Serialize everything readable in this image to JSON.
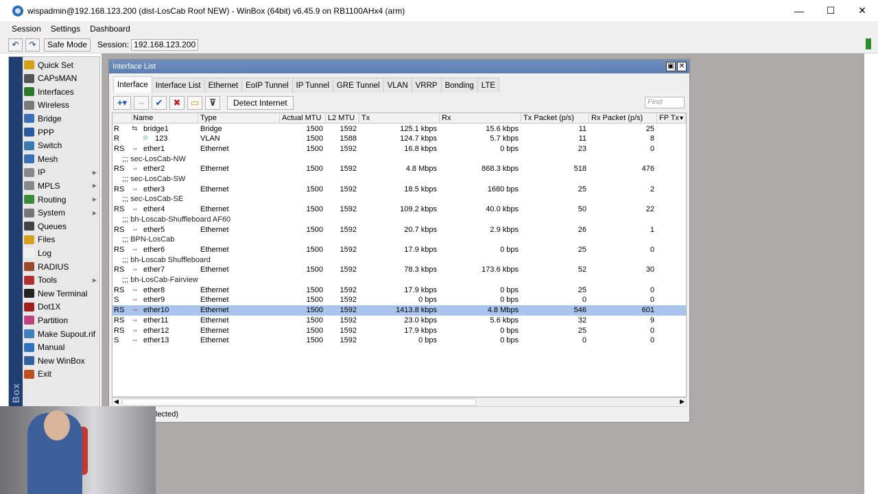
{
  "window": {
    "title": "wispadmin@192.168.123.200 (dist-LosCab Roof NEW) - WinBox (64bit) v6.45.9 on RB1100AHx4 (arm)",
    "minimize": "—",
    "maximize": "☐",
    "close": "✕"
  },
  "menubar": [
    "Session",
    "Settings",
    "Dashboard"
  ],
  "toolbar": {
    "undo": "↶",
    "redo": "↷",
    "safe_mode": "Safe Mode",
    "session_label": "Session:",
    "session_value": "192.168.123.200"
  },
  "sidebar": {
    "brand": "RouterOS WinBox",
    "items": [
      {
        "label": "Quick Set",
        "color": "#d4a017",
        "arrow": false
      },
      {
        "label": "CAPsMAN",
        "color": "#555555",
        "arrow": false
      },
      {
        "label": "Interfaces",
        "color": "#2b7a2b",
        "arrow": false
      },
      {
        "label": "Wireless",
        "color": "#7a7a7a",
        "arrow": false
      },
      {
        "label": "Bridge",
        "color": "#3b6fb6",
        "arrow": false
      },
      {
        "label": "PPP",
        "color": "#2a5aa0",
        "arrow": false
      },
      {
        "label": "Switch",
        "color": "#3a7ab0",
        "arrow": false
      },
      {
        "label": "Mesh",
        "color": "#3b6fb6",
        "arrow": false
      },
      {
        "label": "IP",
        "color": "#888888",
        "arrow": true
      },
      {
        "label": "MPLS",
        "color": "#888888",
        "arrow": true
      },
      {
        "label": "Routing",
        "color": "#3a8a3a",
        "arrow": true
      },
      {
        "label": "System",
        "color": "#777777",
        "arrow": true
      },
      {
        "label": "Queues",
        "color": "#444444",
        "arrow": false
      },
      {
        "label": "Files",
        "color": "#d8a020",
        "arrow": false
      },
      {
        "label": "Log",
        "color": "#f0f0f0",
        "arrow": false
      },
      {
        "label": "RADIUS",
        "color": "#9a4a2a",
        "arrow": false
      },
      {
        "label": "Tools",
        "color": "#b03030",
        "arrow": true
      },
      {
        "label": "New Terminal",
        "color": "#222222",
        "arrow": false
      },
      {
        "label": "Dot1X",
        "color": "#a02020",
        "arrow": false
      },
      {
        "label": "Partition",
        "color": "#c04080",
        "arrow": false
      },
      {
        "label": "Make Supout.rif",
        "color": "#4080c0",
        "arrow": false
      },
      {
        "label": "Manual",
        "color": "#3070c0",
        "arrow": false
      },
      {
        "label": "New WinBox",
        "color": "#3060a0",
        "arrow": false
      },
      {
        "label": "Exit",
        "color": "#c05020",
        "arrow": false
      }
    ]
  },
  "interface_window": {
    "title": "Interface List",
    "tabs": [
      "Interface",
      "Interface List",
      "Ethernet",
      "EoIP Tunnel",
      "IP Tunnel",
      "GRE Tunnel",
      "VLAN",
      "VRRP",
      "Bonding",
      "LTE"
    ],
    "actions": {
      "add": "+▾",
      "remove": "−",
      "enable": "✔",
      "disable": "✖",
      "comment": "▭",
      "filter": "⊽",
      "detect": "Detect Internet"
    },
    "find_placeholder": "Find",
    "columns": [
      "Name",
      "Type",
      "Actual MTU",
      "L2 MTU",
      "Tx",
      "Rx",
      "Tx Packet (p/s)",
      "Rx Packet (p/s)",
      "FP Tx"
    ],
    "rows": [
      {
        "kind": "iface",
        "flags": "R",
        "icon": "bridge",
        "name": "bridge1",
        "type": "Bridge",
        "mtu": "1500",
        "l2mtu": "1592",
        "tx": "125.1 kbps",
        "rx": "15.6 kbps",
        "txp": "11",
        "rxp": "25"
      },
      {
        "kind": "iface",
        "flags": "R",
        "icon": "vlan",
        "name": "123",
        "type": "VLAN",
        "mtu": "1500",
        "l2mtu": "1588",
        "tx": "124.7 kbps",
        "rx": "5.7 kbps",
        "txp": "11",
        "rxp": "8"
      },
      {
        "kind": "iface",
        "flags": "RS",
        "icon": "eth",
        "name": "ether1",
        "type": "Ethernet",
        "mtu": "1500",
        "l2mtu": "1592",
        "tx": "16.8 kbps",
        "rx": "0 bps",
        "txp": "23",
        "rxp": "0"
      },
      {
        "kind": "comment",
        "text": ";;; sec-LosCab-NW"
      },
      {
        "kind": "iface",
        "flags": "RS",
        "icon": "eth",
        "name": "ether2",
        "type": "Ethernet",
        "mtu": "1500",
        "l2mtu": "1592",
        "tx": "4.8 Mbps",
        "rx": "868.3 kbps",
        "txp": "518",
        "rxp": "476"
      },
      {
        "kind": "comment",
        "text": ";;; sec-LosCab-SW"
      },
      {
        "kind": "iface",
        "flags": "RS",
        "icon": "eth",
        "name": "ether3",
        "type": "Ethernet",
        "mtu": "1500",
        "l2mtu": "1592",
        "tx": "18.5 kbps",
        "rx": "1680 bps",
        "txp": "25",
        "rxp": "2"
      },
      {
        "kind": "comment",
        "text": ";;; sec-LosCab-SE"
      },
      {
        "kind": "iface",
        "flags": "RS",
        "icon": "eth",
        "name": "ether4",
        "type": "Ethernet",
        "mtu": "1500",
        "l2mtu": "1592",
        "tx": "109.2 kbps",
        "rx": "40.0 kbps",
        "txp": "50",
        "rxp": "22"
      },
      {
        "kind": "comment",
        "text": ";;; bh-Loscab-Shuffleboard AF60"
      },
      {
        "kind": "iface",
        "flags": "RS",
        "icon": "eth",
        "name": "ether5",
        "type": "Ethernet",
        "mtu": "1500",
        "l2mtu": "1592",
        "tx": "20.7 kbps",
        "rx": "2.9 kbps",
        "txp": "26",
        "rxp": "1"
      },
      {
        "kind": "comment",
        "text": ";;; BPN-LosCab"
      },
      {
        "kind": "iface",
        "flags": "RS",
        "icon": "eth",
        "name": "ether6",
        "type": "Ethernet",
        "mtu": "1500",
        "l2mtu": "1592",
        "tx": "17.9 kbps",
        "rx": "0 bps",
        "txp": "25",
        "rxp": "0"
      },
      {
        "kind": "comment",
        "text": ";;; bh-Loscab Shuffleboard"
      },
      {
        "kind": "iface",
        "flags": "RS",
        "icon": "eth",
        "name": "ether7",
        "type": "Ethernet",
        "mtu": "1500",
        "l2mtu": "1592",
        "tx": "78.3 kbps",
        "rx": "173.6 kbps",
        "txp": "52",
        "rxp": "30"
      },
      {
        "kind": "comment",
        "text": ";;; bh-LosCab-Fairview"
      },
      {
        "kind": "iface",
        "flags": "RS",
        "icon": "eth",
        "name": "ether8",
        "type": "Ethernet",
        "mtu": "1500",
        "l2mtu": "1592",
        "tx": "17.9 kbps",
        "rx": "0 bps",
        "txp": "25",
        "rxp": "0"
      },
      {
        "kind": "iface",
        "flags": "S",
        "icon": "eth",
        "name": "ether9",
        "type": "Ethernet",
        "mtu": "1500",
        "l2mtu": "1592",
        "tx": "0 bps",
        "rx": "0 bps",
        "txp": "0",
        "rxp": "0"
      },
      {
        "kind": "iface",
        "flags": "RS",
        "icon": "eth",
        "name": "ether10",
        "type": "Ethernet",
        "mtu": "1500",
        "l2mtu": "1592",
        "tx": "1413.8 kbps",
        "rx": "4.8 Mbps",
        "txp": "546",
        "rxp": "601",
        "selected": true
      },
      {
        "kind": "iface",
        "flags": "RS",
        "icon": "eth",
        "name": "ether11",
        "type": "Ethernet",
        "mtu": "1500",
        "l2mtu": "1592",
        "tx": "23.0 kbps",
        "rx": "5.6 kbps",
        "txp": "32",
        "rxp": "9"
      },
      {
        "kind": "iface",
        "flags": "RS",
        "icon": "eth",
        "name": "ether12",
        "type": "Ethernet",
        "mtu": "1500",
        "l2mtu": "1592",
        "tx": "17.9 kbps",
        "rx": "0 bps",
        "txp": "25",
        "rxp": "0"
      },
      {
        "kind": "iface",
        "flags": "S",
        "icon": "eth",
        "name": "ether13",
        "type": "Ethernet",
        "mtu": "1500",
        "l2mtu": "1592",
        "tx": "0 bps",
        "rx": "0 bps",
        "txp": "0",
        "rxp": "0"
      }
    ],
    "status_text": "lected)"
  },
  "colors": {
    "selected_row": "#a8c4ec",
    "title_gradient": "#6f8fbf",
    "desktop_bg": "#abaaa8"
  }
}
